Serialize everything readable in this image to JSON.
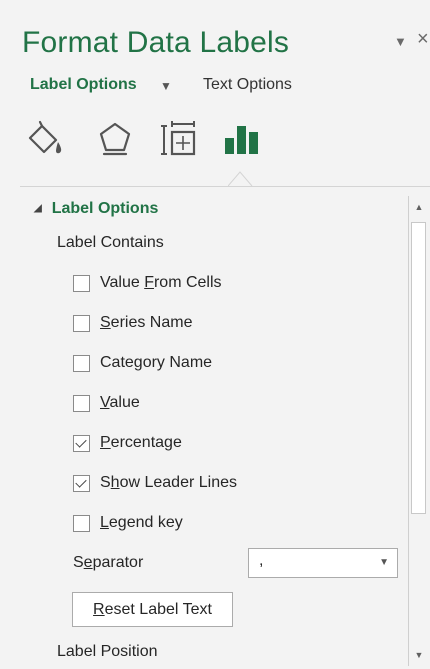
{
  "pane": {
    "title": "Format Data Labels",
    "pin_icon": "chevron-down-icon",
    "close_icon": "close-icon",
    "close_glyph": "×",
    "accent_color": "#217346"
  },
  "tabs": {
    "label_options": "Label Options",
    "caret": "▼",
    "text_options": "Text Options"
  },
  "icon_tabs": [
    {
      "name": "fill-line-icon"
    },
    {
      "name": "effects-icon"
    },
    {
      "name": "size-properties-icon"
    },
    {
      "name": "label-options-icon",
      "selected": true
    }
  ],
  "section": {
    "title": "Label Options",
    "collapse_glyph": "◢"
  },
  "label_contains": {
    "heading": "Label Contains",
    "options": [
      {
        "pre": "Value ",
        "key": "F",
        "post": "rom Cells",
        "checked": false
      },
      {
        "pre": "",
        "key": "S",
        "post": "eries Name",
        "checked": false
      },
      {
        "pre": "Cate",
        "key": "g",
        "post": "ory Name",
        "checked": false
      },
      {
        "pre": "",
        "key": "V",
        "post": "alue",
        "checked": false
      },
      {
        "pre": "",
        "key": "P",
        "post": "ercentage",
        "checked": true
      },
      {
        "pre": "S",
        "key": "h",
        "post": "ow Leader Lines",
        "checked": true
      },
      {
        "pre": "",
        "key": "L",
        "post": "egend key",
        "checked": false
      }
    ]
  },
  "separator": {
    "label_pre": "S",
    "label_key": "e",
    "label_post": "parator",
    "value": ","
  },
  "reset": {
    "pre": "",
    "key": "R",
    "post": "eset Label Text"
  },
  "label_position": {
    "heading": "Label Position"
  },
  "scrollbar": {
    "up": "▲",
    "down": "▼"
  }
}
